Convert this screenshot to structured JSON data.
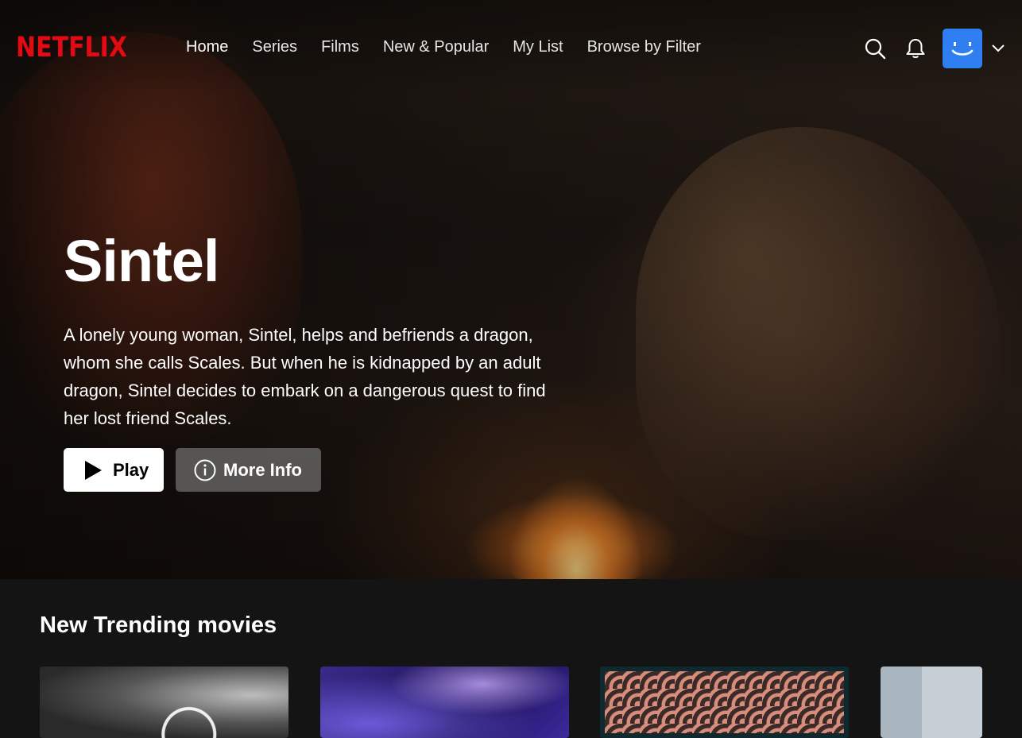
{
  "brand": {
    "logo_text": "NETFLIX",
    "logo_color": "#e50914"
  },
  "nav": {
    "links": [
      {
        "label": "Home",
        "active": true
      },
      {
        "label": "Series",
        "active": false
      },
      {
        "label": "Films",
        "active": false
      },
      {
        "label": "New & Popular",
        "active": false
      },
      {
        "label": "My List",
        "active": false
      },
      {
        "label": "Browse by Filter",
        "active": false
      }
    ],
    "icons": [
      "search-icon",
      "bell-icon",
      "profile-avatar",
      "chevron-down-icon"
    ],
    "avatar_color": "#2f7ff2"
  },
  "hero": {
    "title": "Sintel",
    "description": "A lonely young woman, Sintel, helps and befriends a dragon, whom she calls Scales. But when he is kidnapped by an adult dragon, Sintel decides to embark on a dangerous quest to find her lost friend Scales.",
    "play_label": "Play",
    "info_label": "More Info"
  },
  "row": {
    "title": "New Trending movies",
    "cards": [
      {
        "name": "trending-card-1"
      },
      {
        "name": "trending-card-2"
      },
      {
        "name": "trending-card-3"
      },
      {
        "name": "trending-card-4"
      }
    ]
  }
}
